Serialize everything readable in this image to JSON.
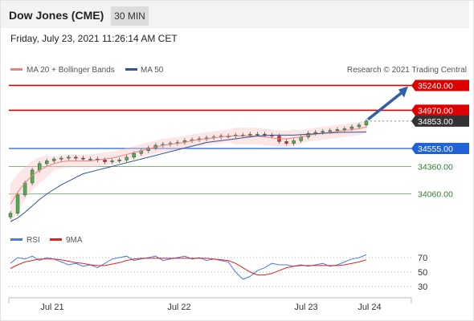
{
  "header": {
    "title": "Dow Jones (CME)",
    "timeframe": "30 MIN",
    "datetime": "Friday, July 23, 2021 11:26:14 AM CET"
  },
  "legend": {
    "bollinger": "MA 20 + Bollinger Bands",
    "ma50": "MA 50",
    "credit": "Research © 2021 Trading Central",
    "rsi": "RSI",
    "ma9": "9MA"
  },
  "colors": {
    "resistance": "#dd0000",
    "support": "#1f63d6",
    "target_line": "#4d9a4d",
    "current": "#333333",
    "bollinger": "#f08080",
    "ma50": "#2f5597",
    "rsi": "#4b7be0",
    "rsi_ma": "#e02020",
    "arrow": "#2f5fa8"
  },
  "chart_data": [
    {
      "type": "line",
      "subtype": "candlestick-price",
      "title": "Dow Jones (CME)",
      "ylim": [
        33700,
        35340
      ],
      "x_ticks": [
        "Jul 21",
        "Jul 22",
        "Jul 23",
        "Jul 24"
      ],
      "levels": [
        {
          "value": 35240,
          "label": "35240.00",
          "kind": "resistance"
        },
        {
          "value": 34970,
          "label": "34970.00",
          "kind": "resistance"
        },
        {
          "value": 34853,
          "label": "34853.00",
          "kind": "current"
        },
        {
          "value": 34555,
          "label": "34555.00",
          "kind": "pivot"
        },
        {
          "value": 34360,
          "label": "34360.00",
          "kind": "target"
        },
        {
          "value": 34060,
          "label": "34060.00",
          "kind": "target"
        }
      ],
      "series": [
        {
          "name": "Price",
          "values": [
            33850,
            34050,
            34180,
            34320,
            34390,
            34420,
            34440,
            34450,
            34460,
            34450,
            34440,
            34440,
            34430,
            34410,
            34420,
            34430,
            34460,
            34500,
            34530,
            34560,
            34590,
            34600,
            34610,
            34620,
            34640,
            34650,
            34660,
            34670,
            34680,
            34690,
            34690,
            34700,
            34700,
            34710,
            34710,
            34700,
            34690,
            34630,
            34610,
            34640,
            34680,
            34720,
            34730,
            34740,
            34750,
            34760,
            34770,
            34790,
            34810,
            34853
          ]
        },
        {
          "name": "MA 20 + Bollinger Bands",
          "values": [
            33950,
            34080,
            34180,
            34260,
            34320,
            34360,
            34390,
            34410,
            34420,
            34420,
            34420,
            34420,
            34430,
            34440,
            34450,
            34470,
            34490,
            34510,
            34530,
            34550,
            34570,
            34590,
            34600,
            34610,
            34620,
            34640,
            34650,
            34660,
            34670,
            34680,
            34690,
            34690,
            34690,
            34690,
            34690,
            34680,
            34670,
            34660,
            34660,
            34670,
            34680,
            34700,
            34710,
            34720,
            34730,
            34740,
            34750,
            34760,
            34770,
            34790
          ]
        },
        {
          "name": "MA 50",
          "values": [
            33760,
            33800,
            33860,
            33930,
            34000,
            34060,
            34110,
            34160,
            34200,
            34240,
            34280,
            34300,
            34320,
            34340,
            34360,
            34380,
            34400,
            34420,
            34440,
            34460,
            34480,
            34500,
            34520,
            34540,
            34560,
            34580,
            34600,
            34620,
            34630,
            34640,
            34650,
            34660,
            34670,
            34680,
            34690,
            34695,
            34700,
            34700,
            34700,
            34700,
            34705,
            34710,
            34715,
            34720,
            34725,
            34728,
            34730,
            34732,
            34733,
            34735
          ]
        }
      ],
      "forecast_arrow": {
        "from": 34853,
        "to": 35240
      }
    },
    {
      "type": "line",
      "subtype": "rsi",
      "ylim": [
        20,
        80
      ],
      "y_ticks": [
        70,
        50,
        30
      ],
      "series": [
        {
          "name": "RSI",
          "values": [
            62,
            70,
            68,
            72,
            66,
            70,
            68,
            64,
            60,
            62,
            58,
            60,
            56,
            62,
            68,
            70,
            72,
            66,
            68,
            70,
            72,
            66,
            68,
            70,
            72,
            68,
            70,
            66,
            68,
            66,
            64,
            50,
            40,
            44,
            52,
            56,
            62,
            60,
            60,
            58,
            60,
            58,
            60,
            62,
            58,
            60,
            64,
            68,
            70,
            74
          ]
        },
        {
          "name": "9MA",
          "values": [
            55,
            60,
            64,
            66,
            68,
            68,
            68,
            67,
            65,
            63,
            62,
            60,
            59,
            59,
            61,
            63,
            66,
            68,
            69,
            69,
            69,
            69,
            69,
            69,
            69,
            69,
            69,
            69,
            68,
            67,
            66,
            62,
            56,
            50,
            46,
            46,
            48,
            52,
            56,
            58,
            59,
            59,
            59,
            59,
            59,
            59,
            60,
            62,
            64,
            67
          ]
        }
      ]
    }
  ]
}
